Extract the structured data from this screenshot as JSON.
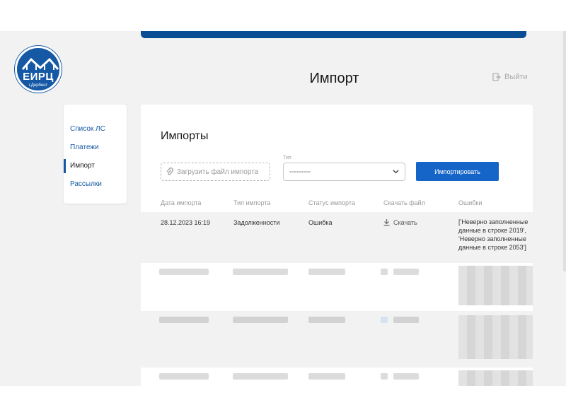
{
  "logo": {
    "title": "ЕИРЦ",
    "subtitle": "г.Дербент"
  },
  "header": {
    "title": "Импорт",
    "logout_label": "Выйти"
  },
  "sidebar": {
    "items": [
      {
        "label": "Список ЛС",
        "active": false
      },
      {
        "label": "Платежи",
        "active": false
      },
      {
        "label": "Импорт",
        "active": true
      },
      {
        "label": "Рассылки",
        "active": false
      }
    ]
  },
  "imports": {
    "title": "Импорты",
    "upload_label": "Загрузить файл импорта",
    "type_label": "Тип",
    "type_value": "---------",
    "import_button": "Импортировать",
    "columns": [
      "Дата импорта",
      "Тип импорта",
      "Статус импорта",
      "Скачать файл",
      "Ошибки"
    ],
    "row": {
      "date": "28.12.2023 16:19",
      "type": "Задолженности",
      "status": "Ошибка",
      "download": "Скачать",
      "errors": "['Неверно заполненные данные в строке 2019', 'Неверно заполненные данные в строке 2053']"
    }
  },
  "colors": {
    "accent": "#1565c8",
    "brand": "#0a4d92",
    "link": "#1558a4"
  }
}
